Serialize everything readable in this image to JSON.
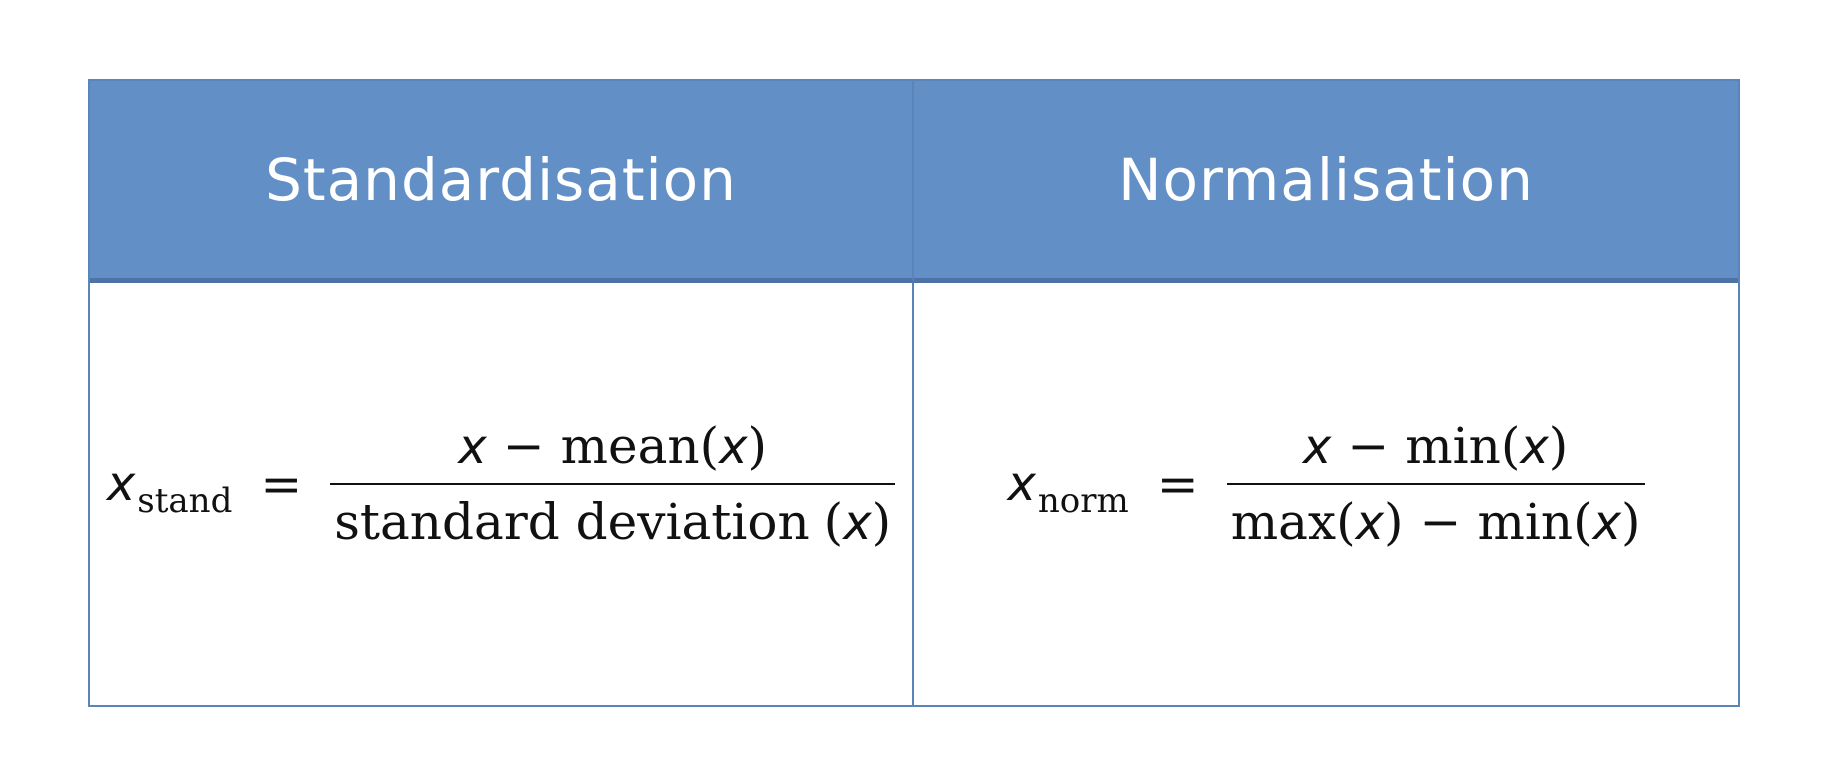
{
  "headers": {
    "left": "Standardisation",
    "right": "Normalisation"
  },
  "standardisation": {
    "var": "x",
    "subscript": "stand",
    "equals": "=",
    "numerator": {
      "var": "x",
      "op": "−",
      "func": "mean",
      "lparen": "(",
      "arg": "x",
      "rparen": ")"
    },
    "denominator": {
      "text": "standard deviation",
      "lparen": "(",
      "arg": "x",
      "rparen": ")"
    }
  },
  "normalisation": {
    "var": "x",
    "subscript": "norm",
    "equals": "=",
    "numerator": {
      "var": "x",
      "op": "−",
      "func": "min",
      "lparen": "(",
      "arg": "x",
      "rparen": ")"
    },
    "denominator": {
      "func1": "max",
      "lparen1": "(",
      "arg1": "x",
      "rparen1": ")",
      "op": "−",
      "func2": "min",
      "lparen2": "(",
      "arg2": "x",
      "rparen2": ")"
    }
  },
  "colors": {
    "header_bg": "#628fc5",
    "border": "#5b84b8",
    "header_text": "#ffffff"
  }
}
